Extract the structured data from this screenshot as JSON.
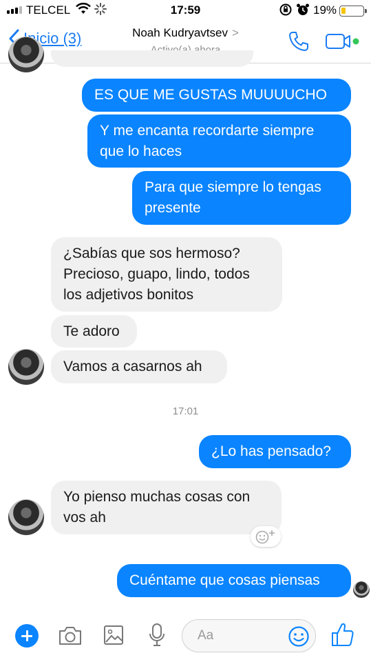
{
  "status_bar": {
    "carrier": "TELCEL",
    "time": "17:59",
    "battery_percent_text": "19%",
    "battery_level": 0.19
  },
  "nav": {
    "back_label": "Inicio (3)",
    "contact_name": "Noah Kudryavtsev",
    "contact_status": "Activo(a) ahora"
  },
  "messages": [
    {
      "side": "out",
      "text": "ES QUE ME GUSTAS MUUUUCHO"
    },
    {
      "side": "out",
      "lines": [
        "Y me encanta recordarte siempre",
        "que lo haces"
      ]
    },
    {
      "side": "out",
      "lines": [
        "Para que siempre lo tengas",
        "presente"
      ]
    },
    {
      "side": "in",
      "lines": [
        "¿Sabías que sos hermoso?",
        "Precioso, guapo, lindo, todos",
        "los adjetivos bonitos"
      ]
    },
    {
      "side": "in",
      "text": "Te adoro"
    },
    {
      "side": "in",
      "text": "Vamos a casarnos ah"
    },
    {
      "side": "out",
      "text": "¿Lo has pensado?"
    },
    {
      "side": "in",
      "lines": [
        "Yo pienso muchas cosas con",
        "vos ah"
      ]
    },
    {
      "side": "out",
      "text": "Cuéntame que cosas piensas"
    }
  ],
  "timestamp": "17:01",
  "composer": {
    "placeholder": "Aa"
  },
  "colors": {
    "accent": "#0a84ff",
    "incoming_bubble": "#f0f0f0",
    "online_dot": "#34c759",
    "battery": "#f5c400"
  }
}
